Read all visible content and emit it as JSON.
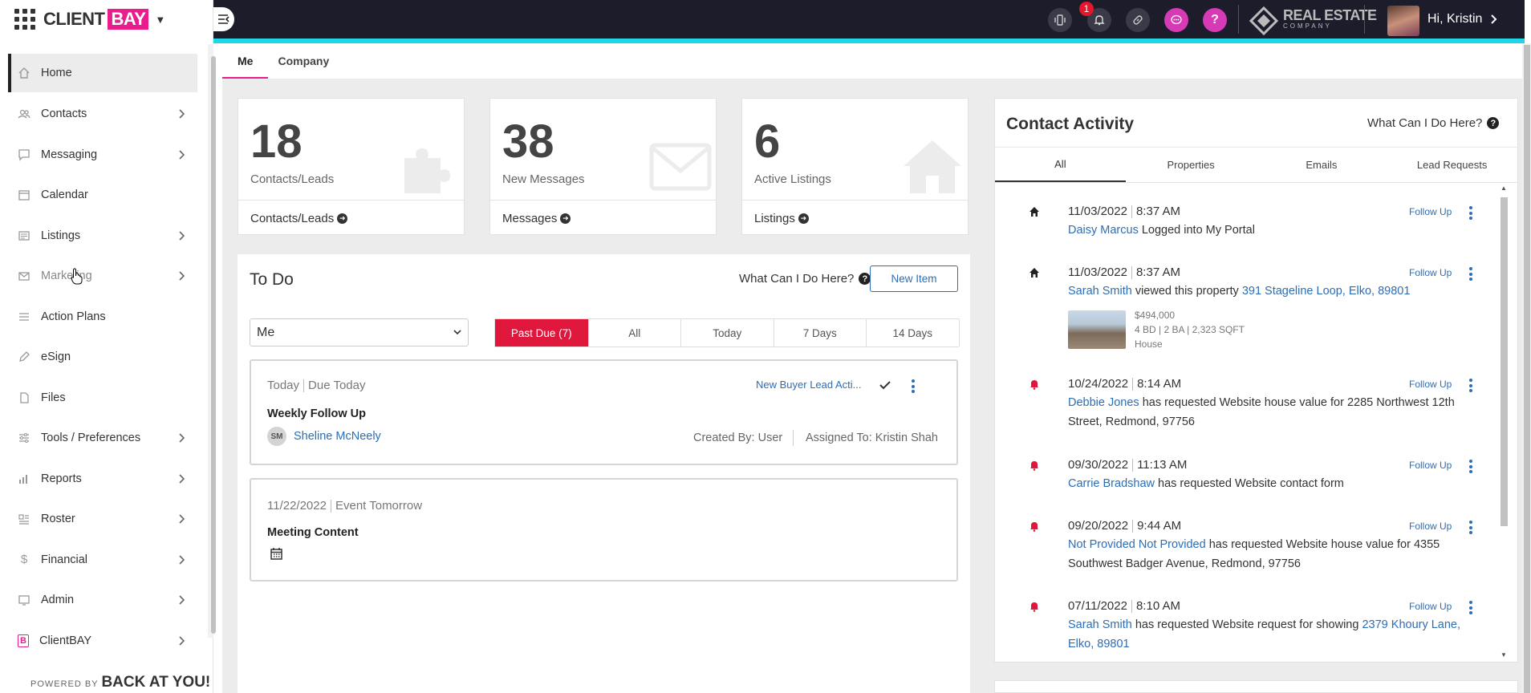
{
  "brand": {
    "client": "CLIENT",
    "bay": "BAY"
  },
  "sidebar": {
    "items": [
      {
        "label": "Home",
        "icon": "home-icon"
      },
      {
        "label": "Contacts",
        "icon": "contacts-icon"
      },
      {
        "label": "Messaging",
        "icon": "message-icon"
      },
      {
        "label": "Calendar",
        "icon": "calendar-icon"
      },
      {
        "label": "Listings",
        "icon": "listings-icon"
      },
      {
        "label": "Marketing",
        "icon": "marketing-icon"
      },
      {
        "label": "Action Plans",
        "icon": "action-plans-icon"
      },
      {
        "label": "eSign",
        "icon": "pen-icon"
      },
      {
        "label": "Files",
        "icon": "file-icon"
      },
      {
        "label": "Tools / Preferences",
        "icon": "sliders-icon"
      },
      {
        "label": "Reports",
        "icon": "bar-chart-icon"
      },
      {
        "label": "Roster",
        "icon": "roster-icon"
      },
      {
        "label": "Financial",
        "icon": "dollar-icon"
      },
      {
        "label": "Admin",
        "icon": "admin-icon"
      },
      {
        "label": "ClientBAY",
        "icon": "clientbay-icon"
      }
    ],
    "powered_prefix": "POWERED BY",
    "powered_brand": "BACK AT YOU!"
  },
  "topbar": {
    "notification_count": "1",
    "company_name": "REAL ESTATE",
    "company_sub": "COMPANY",
    "greeting": "Hi, Kristin"
  },
  "tabs": [
    "Me",
    "Company"
  ],
  "stats": [
    {
      "value": "18",
      "label": "Contacts/Leads",
      "link": "Contacts/Leads"
    },
    {
      "value": "38",
      "label": "New Messages",
      "link": "Messages"
    },
    {
      "value": "6",
      "label": "Active Listings",
      "link": "Listings"
    }
  ],
  "todo": {
    "title": "To Do",
    "help": "What Can I Do Here?",
    "new_item": "New Item",
    "assignee_select": "Me",
    "filters": [
      "Past Due (7)",
      "All",
      "Today",
      "7 Days",
      "14 Days"
    ],
    "tasks": [
      {
        "date": "Today",
        "due": "Due Today",
        "tag": "New Buyer Lead Acti...",
        "title": "Weekly Follow Up",
        "initials": "SM",
        "contact": "Sheline McNeely",
        "created_by": "Created By: User",
        "assigned_to": "Assigned To: Kristin Shah"
      },
      {
        "date": "11/22/2022",
        "due": "Event Tomorrow",
        "title": "Meeting Content"
      }
    ]
  },
  "activity": {
    "title": "Contact Activity",
    "help": "What Can I Do Here?",
    "tabs": [
      "All",
      "Properties",
      "Emails",
      "Lead Requests"
    ],
    "follow_up": "Follow Up",
    "items": [
      {
        "date": "11/03/2022",
        "time": "8:37 AM",
        "name": "Daisy Marcus",
        "text": " Logged into My Portal"
      },
      {
        "date": "11/03/2022",
        "time": "8:37 AM",
        "name": "Sarah Smith",
        "text": " viewed this property ",
        "link": "391 Stageline Loop, Elko, 89801",
        "price": "$494,000",
        "specs": "4 BD | 2 BA | 2,323 SQFT",
        "ptype": "House"
      },
      {
        "date": "10/24/2022",
        "time": "8:14 AM",
        "name": "Debbie Jones",
        "text": " has requested Website house value for 2285 Northwest 12th Street, Redmond, 97756"
      },
      {
        "date": "09/30/2022",
        "time": "11:13 AM",
        "name": "Carrie Bradshaw",
        "text": " has requested Website contact form"
      },
      {
        "date": "09/20/2022",
        "time": "9:44 AM",
        "name": "Not Provided Not Provided",
        "text": " has requested Website house value for 4355 Southwest Badger Avenue, Redmond, 97756"
      },
      {
        "date": "07/11/2022",
        "time": "8:10 AM",
        "name": "Sarah Smith",
        "text": " has requested Website request for showing ",
        "link": "2379 Khoury Lane, Elko, 89801"
      }
    ]
  },
  "colors": {
    "accent_pink": "#e91e8c",
    "topbar": "#1c1c2b",
    "cyan": "#1fd6e6",
    "link": "#2d6db5",
    "past_due": "#e0173d"
  }
}
